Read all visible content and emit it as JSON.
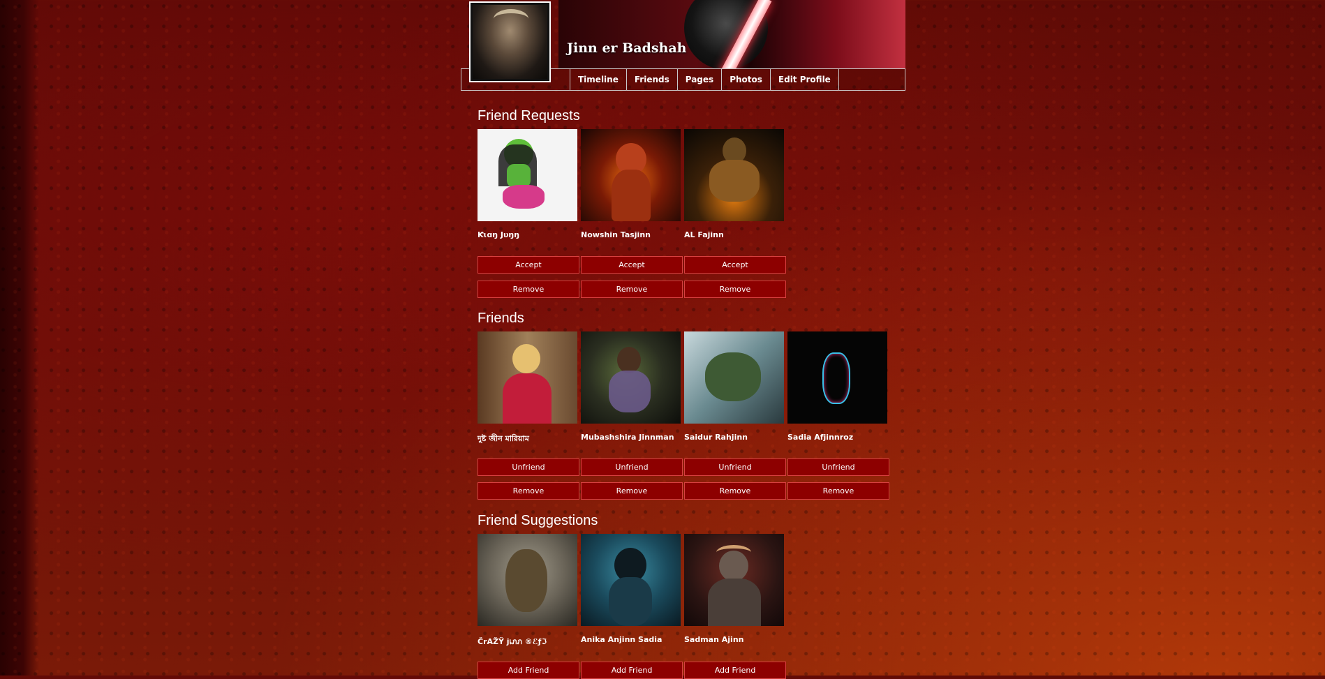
{
  "profile": {
    "name": "Jinn er Badshah"
  },
  "nav": {
    "items": [
      "Timeline",
      "Friends",
      "Pages",
      "Photos",
      "Edit Profile"
    ]
  },
  "friend_requests": {
    "title": "Friend Requests",
    "cards": [
      {
        "name": "Ƙɩɑŋ Jυŋŋ",
        "accept": "Accept",
        "remove": "Remove"
      },
      {
        "name": "Nowshin Tasjinn",
        "accept": "Accept",
        "remove": "Remove"
      },
      {
        "name": "AL Fajinn",
        "accept": "Accept",
        "remove": "Remove"
      }
    ]
  },
  "friends": {
    "title": "Friends",
    "cards": [
      {
        "name": "দুষ্ট জীন মারিয়াম",
        "unfriend": "Unfriend",
        "remove": "Remove"
      },
      {
        "name": "Mubashshira Jinnman",
        "unfriend": "Unfriend",
        "remove": "Remove"
      },
      {
        "name": "Saidur Rahjinn",
        "unfriend": "Unfriend",
        "remove": "Remove"
      },
      {
        "name": "Sadia Afjinnroz",
        "unfriend": "Unfriend",
        "remove": "Remove"
      }
    ]
  },
  "suggestions": {
    "title": "Friend Suggestions",
    "cards": [
      {
        "name": "ČrAŽŸ jเภภ ®ℰƒℑ",
        "add": "Add Friend"
      },
      {
        "name": "Anika Anjinn Sadia",
        "add": "Add Friend"
      },
      {
        "name": "Sadman Ajinn",
        "add": "Add Friend"
      }
    ]
  },
  "colors": {
    "button_bg": "#8d0000",
    "button_border": "#d84040",
    "background": "#6b0f08"
  }
}
